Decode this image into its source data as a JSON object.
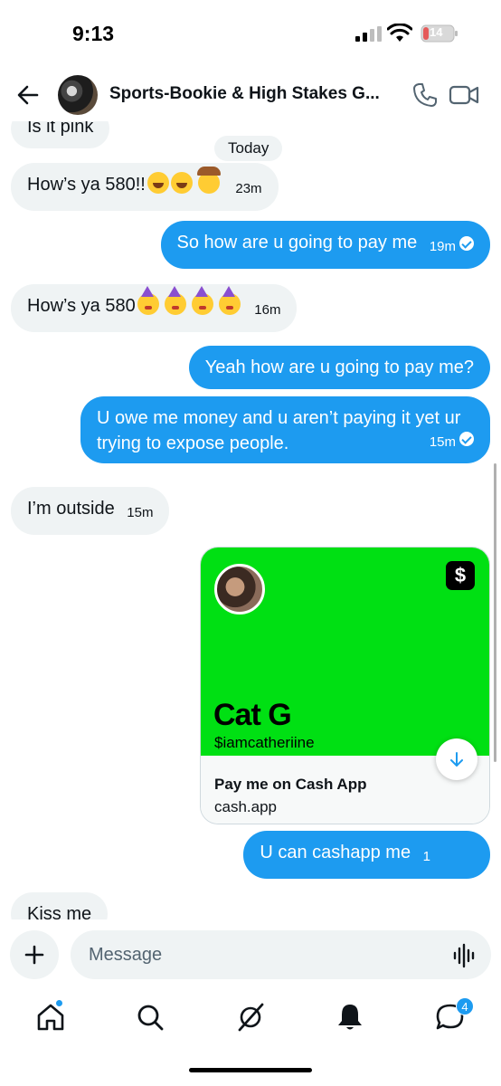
{
  "status_bar": {
    "time": "9:13",
    "battery": "14"
  },
  "header": {
    "title": "Sports-Bookie & High Stakes G..."
  },
  "messages": {
    "m1": {
      "text": "Is it pink"
    },
    "today": "Today",
    "m2": {
      "text": "How’s ya 580!!",
      "time": "23m"
    },
    "m3": {
      "text": "So how are u going to pay me",
      "time": "19m"
    },
    "m4": {
      "text": "How’s ya 580",
      "time": "16m"
    },
    "m5": {
      "text": "Yeah how are u going to pay me?"
    },
    "m6": {
      "text": "U owe me money and u aren’t paying it yet ur trying to expose people.",
      "time": "15m"
    },
    "m7": {
      "text": "I’m outside",
      "time": "15m"
    },
    "card": {
      "name": "Cat G",
      "handle": "$iamcatheriine",
      "cta": "Pay me on Cash App",
      "domain": "cash.app",
      "logo": "$"
    },
    "m8": {
      "text": "U can cashapp me",
      "time": "1"
    },
    "m9": {
      "text": "Kiss me"
    }
  },
  "compose": {
    "placeholder": "Message"
  },
  "tabbar": {
    "messages_badge": "4"
  },
  "colors": {
    "sent_bubble": "#1d9bf0",
    "received_bubble": "#eff3f4",
    "cash_green": "#00e013"
  },
  "icons": [
    "back-arrow-icon",
    "phone-icon",
    "video-icon",
    "plus-icon",
    "voice-icon",
    "home-icon",
    "search-icon",
    "grok-icon",
    "bell-icon",
    "messages-icon",
    "arrow-down-icon"
  ]
}
